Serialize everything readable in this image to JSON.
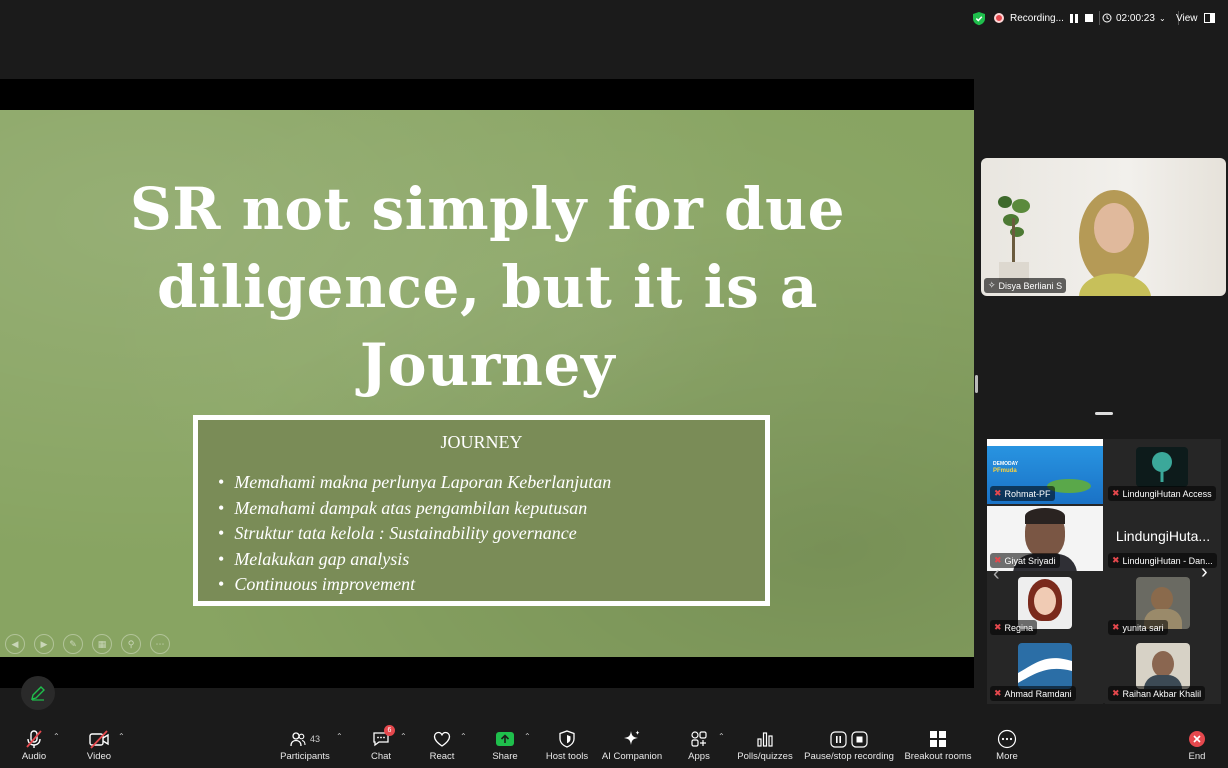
{
  "status_bar": {
    "recording_label": "Recording...",
    "timer": "02:00:23",
    "view_label": "View"
  },
  "slide": {
    "title": "SR not simply for due diligence, but it is a Journey",
    "box_heading": "JOURNEY",
    "bullets": [
      "Memahami makna perlunya Laporan Keberlanjutan",
      "Memahami dampak atas pengambilan keputusan",
      "Struktur tata kelola : Sustainability governance",
      "Melakukan gap analysis",
      "Continuous improvement"
    ]
  },
  "speaker": {
    "name": "Disya Berliani S"
  },
  "gallery": {
    "tiles": [
      {
        "name": "Rohmat-PF",
        "banner_top": "DEMODAY",
        "banner_sub": "PFmuda"
      },
      {
        "name": "LindungiHutan Access"
      },
      {
        "name": "Giyat Sriyadi"
      },
      {
        "name": "LindungiHutan - Dan...",
        "display_text": "LindungiHuta..."
      },
      {
        "name": "Regina"
      },
      {
        "name": "yunita sari"
      },
      {
        "name": "Ahmad Ramdani"
      },
      {
        "name": "Raihan Akbar Khalil"
      }
    ]
  },
  "toolbar": {
    "audio": "Audio",
    "video": "Video",
    "participants": "Participants",
    "participants_count": "43",
    "chat": "Chat",
    "chat_badge": "6",
    "react": "React",
    "share": "Share",
    "host_tools": "Host tools",
    "ai_companion": "AI Companion",
    "apps": "Apps",
    "polls": "Polls/quizzes",
    "pause_stop": "Pause/stop recording",
    "breakout": "Breakout rooms",
    "more": "More",
    "end": "End"
  },
  "colors": {
    "slide_bg": "#88a462",
    "journey_box": "#7a8c57",
    "share_green": "#1fbf4c",
    "recording_red": "#e5484d",
    "end_red": "#e5484d"
  }
}
